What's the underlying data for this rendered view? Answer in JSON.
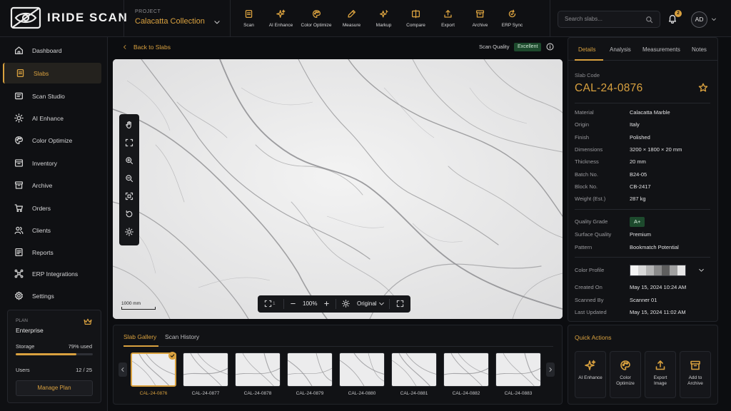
{
  "brand": {
    "name": "IRIDE SCAN",
    "accent": "#d9a13f",
    "background": "#0c0d10"
  },
  "project": {
    "label": "PROJECT",
    "name": "Calacatta Collection"
  },
  "toolbar": [
    {
      "label": "Scan",
      "icon": "scan-icon"
    },
    {
      "label": "AI Enhance",
      "icon": "sparkle-icon"
    },
    {
      "label": "Color Optimize",
      "icon": "palette-icon"
    },
    {
      "label": "Measure",
      "icon": "ruler-pen-icon"
    },
    {
      "label": "Markup",
      "icon": "markup-sparkle-icon"
    },
    {
      "label": "Compare",
      "icon": "compare-icon"
    },
    {
      "label": "Export",
      "icon": "export-icon"
    },
    {
      "label": "Archive",
      "icon": "archive-icon"
    },
    {
      "label": "ERP Sync",
      "icon": "sync-icon"
    }
  ],
  "search": {
    "placeholder": "Search slabs..."
  },
  "notifications": {
    "count": "2"
  },
  "user": {
    "initials": "AD"
  },
  "sidebar": {
    "items": [
      {
        "label": "Dashboard",
        "icon": "home-icon"
      },
      {
        "label": "Slabs",
        "icon": "slabs-icon",
        "active": true
      },
      {
        "label": "Scan Studio",
        "icon": "scan-studio-icon"
      },
      {
        "label": "AI Enhance",
        "icon": "sun-icon"
      },
      {
        "label": "Color Optimize",
        "icon": "palette-icon"
      },
      {
        "label": "Inventory",
        "icon": "inventory-icon"
      },
      {
        "label": "Archive",
        "icon": "archive-icon"
      },
      {
        "label": "Orders",
        "icon": "cart-icon"
      },
      {
        "label": "Clients",
        "icon": "users-icon"
      },
      {
        "label": "Reports",
        "icon": "reports-icon"
      },
      {
        "label": "ERP Integrations",
        "icon": "integrations-icon"
      },
      {
        "label": "Settings",
        "icon": "gear-icon"
      }
    ],
    "plan": {
      "label": "PLAN",
      "name": "Enterprise",
      "storage_label": "Storage",
      "storage_value": "79% used",
      "storage_fraction": 0.79,
      "users_label": "Users",
      "users_value": "12 / 25",
      "button": "Manage Plan"
    }
  },
  "viewer": {
    "back": "Back to Slabs",
    "scan_quality_label": "Scan Quality",
    "scan_quality_value": "Excellent",
    "scale_label": "1000 mm",
    "compare_count": "1",
    "zoom": "100%",
    "view_mode": "Original"
  },
  "gallery": {
    "tabs": [
      "Slab Gallery",
      "Scan History"
    ],
    "active_tab": 0,
    "thumbs": [
      "CAL-24-0876",
      "CAL-24-0877",
      "CAL-24-0878",
      "CAL-24-0879",
      "CAL-24-0880",
      "CAL-24-0881",
      "CAL-24-0882",
      "CAL-24-0883"
    ],
    "selected": 0
  },
  "details": {
    "tabs": [
      "Details",
      "Analysis",
      "Measurements",
      "Notes"
    ],
    "active_tab": 0,
    "code_label": "Slab Code",
    "code": "CAL-24-0876",
    "props": [
      {
        "k": "Material",
        "v": "Calacatta Marble"
      },
      {
        "k": "Origin",
        "v": "Italy"
      },
      {
        "k": "Finish",
        "v": "Polished"
      },
      {
        "k": "Dimensions",
        "v": "3200 × 1800 × 20 mm"
      },
      {
        "k": "Thickness",
        "v": "20 mm"
      },
      {
        "k": "Batch No.",
        "v": "B24-05"
      },
      {
        "k": "Block No.",
        "v": "CB-2417"
      },
      {
        "k": "Weight (Est.)",
        "v": "287 kg"
      }
    ],
    "quality": [
      {
        "k": "Quality Grade",
        "v": "A+"
      },
      {
        "k": "Surface Quality",
        "v": "Premium"
      },
      {
        "k": "Pattern",
        "v": "Bookmatch Potential"
      }
    ],
    "color_profile_label": "Color Profile",
    "color_swatches": [
      "#f4f4f4",
      "#d8d8d8",
      "#b4b4b4",
      "#8a8a8a",
      "#5e5e5e",
      "#a0a0a0",
      "#e6e6e6"
    ],
    "meta": [
      {
        "k": "Created On",
        "v": "May 15, 2024 10:24 AM"
      },
      {
        "k": "Scanned By",
        "v": "Scanner 01"
      },
      {
        "k": "Last Updated",
        "v": "May 15, 2024 11:02 AM"
      }
    ]
  },
  "quick_actions": {
    "title": "Quick Actions",
    "items": [
      {
        "label": "AI Enhance",
        "icon": "sparkle-icon"
      },
      {
        "label": "Color Optimize",
        "icon": "palette-icon"
      },
      {
        "label": "Export Image",
        "icon": "export-icon"
      },
      {
        "label": "Add to Archive",
        "icon": "archive-icon"
      }
    ]
  }
}
